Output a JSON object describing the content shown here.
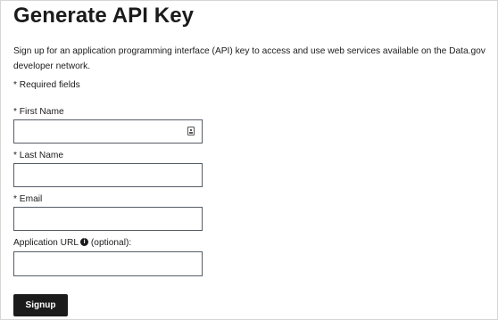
{
  "page": {
    "title": "Generate API Key",
    "description": "Sign up for an application programming interface (API) key to access and use web services available on the Data.gov developer network.",
    "required_note": "* Required fields"
  },
  "form": {
    "first_name": {
      "label": "* First Name",
      "value": ""
    },
    "last_name": {
      "label": "* Last Name",
      "value": ""
    },
    "email": {
      "label": "* Email",
      "value": ""
    },
    "app_url": {
      "label": "Application URL",
      "info_glyph": "i",
      "suffix": "(optional):",
      "value": ""
    },
    "submit_label": "Signup"
  },
  "icons": {
    "autofill": "contact-card-icon",
    "info": "info-icon"
  }
}
